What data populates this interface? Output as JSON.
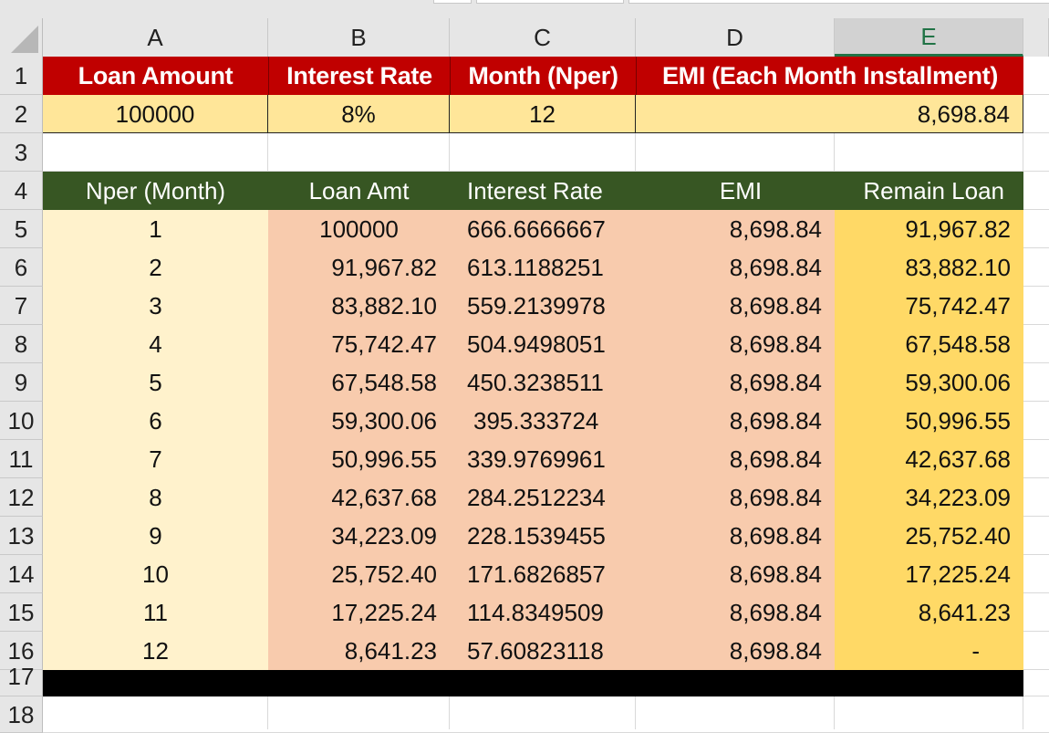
{
  "sheet": {
    "column_headers": [
      "A",
      "B",
      "C",
      "D",
      "E"
    ],
    "selected_column": "E",
    "row_headers": [
      "1",
      "2",
      "3",
      "4",
      "5",
      "6",
      "7",
      "8",
      "9",
      "10",
      "11",
      "12",
      "13",
      "14",
      "15",
      "16",
      "17",
      "18"
    ]
  },
  "summary": {
    "headers": [
      "Loan Amount",
      "Interest Rate",
      "Month (Nper)",
      "EMI (Each Month Installment)"
    ],
    "values": {
      "loan_amount": "100000",
      "interest_rate": "8%",
      "months": "12",
      "emi": "8,698.84"
    }
  },
  "schedule": {
    "headers": [
      "Nper (Month)",
      "Loan Amt",
      "Interest Rate",
      "EMI",
      "Remain Loan"
    ],
    "rows": [
      {
        "nper": "1",
        "loan_amt": "100000",
        "interest": "666.6666667",
        "emi": "8,698.84",
        "remain": "91,967.82"
      },
      {
        "nper": "2",
        "loan_amt": "91,967.82",
        "interest": "613.1188251",
        "emi": "8,698.84",
        "remain": "83,882.10"
      },
      {
        "nper": "3",
        "loan_amt": "83,882.10",
        "interest": "559.2139978",
        "emi": "8,698.84",
        "remain": "75,742.47"
      },
      {
        "nper": "4",
        "loan_amt": "75,742.47",
        "interest": "504.9498051",
        "emi": "8,698.84",
        "remain": "67,548.58"
      },
      {
        "nper": "5",
        "loan_amt": "67,548.58",
        "interest": "450.3238511",
        "emi": "8,698.84",
        "remain": "59,300.06"
      },
      {
        "nper": "6",
        "loan_amt": "59,300.06",
        "interest": "395.333724",
        "emi": "8,698.84",
        "remain": "50,996.55"
      },
      {
        "nper": "7",
        "loan_amt": "50,996.55",
        "interest": "339.9769961",
        "emi": "8,698.84",
        "remain": "42,637.68"
      },
      {
        "nper": "8",
        "loan_amt": "42,637.68",
        "interest": "284.2512234",
        "emi": "8,698.84",
        "remain": "34,223.09"
      },
      {
        "nper": "9",
        "loan_amt": "34,223.09",
        "interest": "228.1539455",
        "emi": "8,698.84",
        "remain": "25,752.40"
      },
      {
        "nper": "10",
        "loan_amt": "25,752.40",
        "interest": "171.6826857",
        "emi": "8,698.84",
        "remain": "17,225.24"
      },
      {
        "nper": "11",
        "loan_amt": "17,225.24",
        "interest": "114.8349509",
        "emi": "8,698.84",
        "remain": "8,641.23"
      },
      {
        "nper": "12",
        "loan_amt": "8,641.23",
        "interest": "57.60823118",
        "emi": "8,698.84",
        "remain": "-"
      }
    ]
  },
  "colors": {
    "summary_header_bg": "#c00000",
    "summary_value_bg": "#ffe699",
    "schedule_header_bg": "#375623",
    "nper_col_bg": "#fff2cc",
    "middle_cols_bg": "#f8cbad",
    "remain_col_bg": "#ffd966",
    "selected_column_accent": "#217346"
  }
}
